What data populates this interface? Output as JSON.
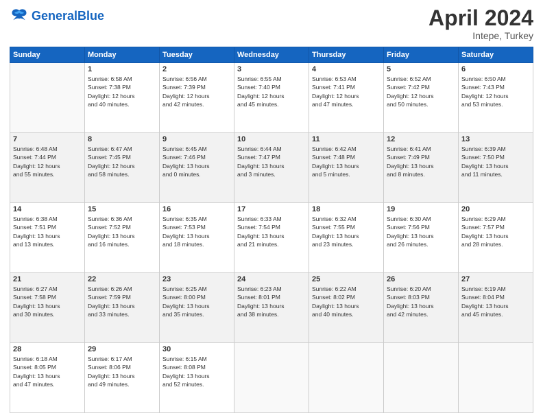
{
  "header": {
    "logo_general": "General",
    "logo_blue": "Blue",
    "month": "April 2024",
    "location": "Intepe, Turkey"
  },
  "days_of_week": [
    "Sunday",
    "Monday",
    "Tuesday",
    "Wednesday",
    "Thursday",
    "Friday",
    "Saturday"
  ],
  "weeks": [
    [
      {
        "day": "",
        "info": ""
      },
      {
        "day": "1",
        "info": "Sunrise: 6:58 AM\nSunset: 7:38 PM\nDaylight: 12 hours\nand 40 minutes."
      },
      {
        "day": "2",
        "info": "Sunrise: 6:56 AM\nSunset: 7:39 PM\nDaylight: 12 hours\nand 42 minutes."
      },
      {
        "day": "3",
        "info": "Sunrise: 6:55 AM\nSunset: 7:40 PM\nDaylight: 12 hours\nand 45 minutes."
      },
      {
        "day": "4",
        "info": "Sunrise: 6:53 AM\nSunset: 7:41 PM\nDaylight: 12 hours\nand 47 minutes."
      },
      {
        "day": "5",
        "info": "Sunrise: 6:52 AM\nSunset: 7:42 PM\nDaylight: 12 hours\nand 50 minutes."
      },
      {
        "day": "6",
        "info": "Sunrise: 6:50 AM\nSunset: 7:43 PM\nDaylight: 12 hours\nand 53 minutes."
      }
    ],
    [
      {
        "day": "7",
        "info": "Sunrise: 6:48 AM\nSunset: 7:44 PM\nDaylight: 12 hours\nand 55 minutes."
      },
      {
        "day": "8",
        "info": "Sunrise: 6:47 AM\nSunset: 7:45 PM\nDaylight: 12 hours\nand 58 minutes."
      },
      {
        "day": "9",
        "info": "Sunrise: 6:45 AM\nSunset: 7:46 PM\nDaylight: 13 hours\nand 0 minutes."
      },
      {
        "day": "10",
        "info": "Sunrise: 6:44 AM\nSunset: 7:47 PM\nDaylight: 13 hours\nand 3 minutes."
      },
      {
        "day": "11",
        "info": "Sunrise: 6:42 AM\nSunset: 7:48 PM\nDaylight: 13 hours\nand 5 minutes."
      },
      {
        "day": "12",
        "info": "Sunrise: 6:41 AM\nSunset: 7:49 PM\nDaylight: 13 hours\nand 8 minutes."
      },
      {
        "day": "13",
        "info": "Sunrise: 6:39 AM\nSunset: 7:50 PM\nDaylight: 13 hours\nand 11 minutes."
      }
    ],
    [
      {
        "day": "14",
        "info": "Sunrise: 6:38 AM\nSunset: 7:51 PM\nDaylight: 13 hours\nand 13 minutes."
      },
      {
        "day": "15",
        "info": "Sunrise: 6:36 AM\nSunset: 7:52 PM\nDaylight: 13 hours\nand 16 minutes."
      },
      {
        "day": "16",
        "info": "Sunrise: 6:35 AM\nSunset: 7:53 PM\nDaylight: 13 hours\nand 18 minutes."
      },
      {
        "day": "17",
        "info": "Sunrise: 6:33 AM\nSunset: 7:54 PM\nDaylight: 13 hours\nand 21 minutes."
      },
      {
        "day": "18",
        "info": "Sunrise: 6:32 AM\nSunset: 7:55 PM\nDaylight: 13 hours\nand 23 minutes."
      },
      {
        "day": "19",
        "info": "Sunrise: 6:30 AM\nSunset: 7:56 PM\nDaylight: 13 hours\nand 26 minutes."
      },
      {
        "day": "20",
        "info": "Sunrise: 6:29 AM\nSunset: 7:57 PM\nDaylight: 13 hours\nand 28 minutes."
      }
    ],
    [
      {
        "day": "21",
        "info": "Sunrise: 6:27 AM\nSunset: 7:58 PM\nDaylight: 13 hours\nand 30 minutes."
      },
      {
        "day": "22",
        "info": "Sunrise: 6:26 AM\nSunset: 7:59 PM\nDaylight: 13 hours\nand 33 minutes."
      },
      {
        "day": "23",
        "info": "Sunrise: 6:25 AM\nSunset: 8:00 PM\nDaylight: 13 hours\nand 35 minutes."
      },
      {
        "day": "24",
        "info": "Sunrise: 6:23 AM\nSunset: 8:01 PM\nDaylight: 13 hours\nand 38 minutes."
      },
      {
        "day": "25",
        "info": "Sunrise: 6:22 AM\nSunset: 8:02 PM\nDaylight: 13 hours\nand 40 minutes."
      },
      {
        "day": "26",
        "info": "Sunrise: 6:20 AM\nSunset: 8:03 PM\nDaylight: 13 hours\nand 42 minutes."
      },
      {
        "day": "27",
        "info": "Sunrise: 6:19 AM\nSunset: 8:04 PM\nDaylight: 13 hours\nand 45 minutes."
      }
    ],
    [
      {
        "day": "28",
        "info": "Sunrise: 6:18 AM\nSunset: 8:05 PM\nDaylight: 13 hours\nand 47 minutes."
      },
      {
        "day": "29",
        "info": "Sunrise: 6:17 AM\nSunset: 8:06 PM\nDaylight: 13 hours\nand 49 minutes."
      },
      {
        "day": "30",
        "info": "Sunrise: 6:15 AM\nSunset: 8:08 PM\nDaylight: 13 hours\nand 52 minutes."
      },
      {
        "day": "",
        "info": ""
      },
      {
        "day": "",
        "info": ""
      },
      {
        "day": "",
        "info": ""
      },
      {
        "day": "",
        "info": ""
      }
    ]
  ]
}
